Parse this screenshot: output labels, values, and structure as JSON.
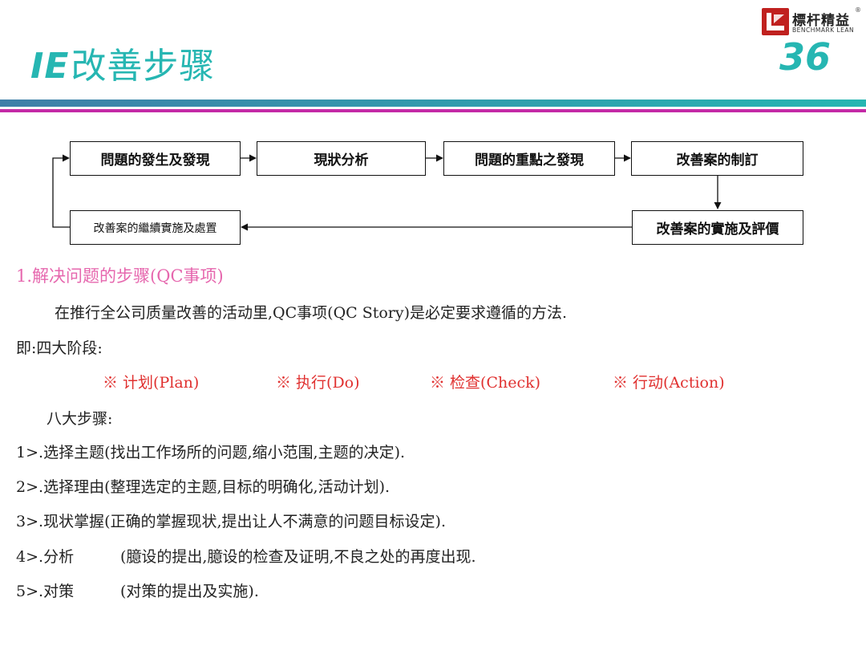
{
  "header": {
    "title_prefix": "IE",
    "title_main": "改善步骤",
    "page_number": "36",
    "logo": {
      "cn": "標杆精益",
      "registered": "®",
      "en": "BENCHMARK LEAN"
    }
  },
  "flow": {
    "step1": "問題的發生及發現",
    "step2": "現狀分析",
    "step3": "問題的重點之發現",
    "step4": "改善案的制訂",
    "step5": "改善案的實施及評價",
    "step6": "改善案的繼續實施及處置"
  },
  "body": {
    "section_title": "1.解决问题的步骤(QC事项)",
    "intro": "在推行全公司质量改善的活动里,QC事项(QC Story)是必定要求遵循的方法.",
    "four_stages_label": "即:四大阶段:",
    "stages": [
      "※ 计划(Plan)",
      "※ 执行(Do)",
      "※ 检查(Check)",
      "※ 行动(Action)"
    ],
    "eight_steps_label": "八大步骤:",
    "steps": [
      {
        "num": "1>.",
        "name": "选择主题",
        "detail": "(找出工作场所的问题,缩小范围,主题的决定)."
      },
      {
        "num": "2>.",
        "name": "选择理由",
        "detail": "(整理选定的主题,目标的明确化,活动计划)."
      },
      {
        "num": "3>.",
        "name": "现状掌握",
        "detail": "(正确的掌握现状,提出让人不满意的问题目标设定)."
      },
      {
        "num": "4>.",
        "name": "分析",
        "detail": "(臆设的提出,臆设的检查及证明,不良之处的再度出现."
      },
      {
        "num": "5>.",
        "name": "对策",
        "detail": "(对策的提出及实施)."
      }
    ]
  },
  "colors": {
    "teal": "#26b6b2",
    "magenta": "#c42aa6",
    "section_pink": "#e667ae",
    "stage_red": "#e0302f",
    "logo_red": "#c0211f"
  }
}
